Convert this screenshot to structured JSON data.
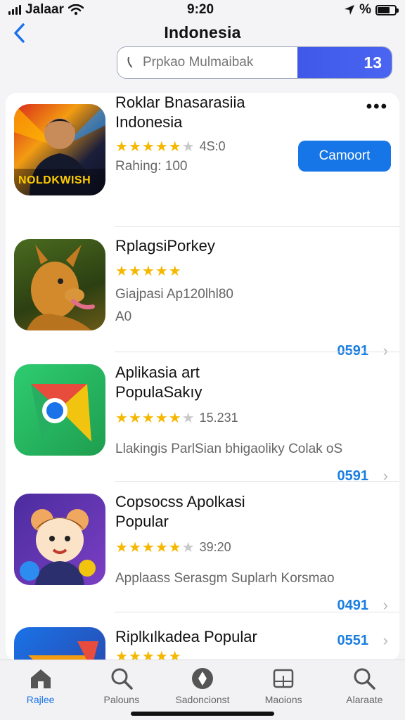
{
  "status": {
    "carrier": "Jalaar",
    "time": "9:20",
    "extra": "%"
  },
  "header": {
    "title": "Indonesia"
  },
  "search": {
    "placeholder": "Prpkao Mulmaibak",
    "count": "13"
  },
  "featured": {
    "name": "Roklar Bnasarasiia Indonesia",
    "rating": "4S:0",
    "sub": "Rahing: 100",
    "action_label": "Camoort",
    "icon_text": "NOLDKWISH"
  },
  "apps": [
    {
      "name": "RplagsiPorkey",
      "rating": "",
      "sub1": "Giajpasi Ap120lhl80",
      "sub2": "A0",
      "price": "0591"
    },
    {
      "name": "Aplikasia art PopulaSakıy",
      "rating": "15.231",
      "sub1": "Llakingis ParlSian bhigaoliky Colak oS",
      "price": "0591"
    },
    {
      "name": "Copsocss Apolkasi Popular",
      "rating": "39:20",
      "sub1": "Applaass Serasgm Suplarh Korsmao",
      "price": "0491"
    },
    {
      "name": "Riplkılkadea Popular",
      "price": "0551"
    }
  ],
  "tabs": [
    {
      "label": "Rajlee",
      "icon": "home-icon"
    },
    {
      "label": "Palouns",
      "icon": "search-icon"
    },
    {
      "label": "Sadoncionst",
      "icon": "compass-icon"
    },
    {
      "label": "Maoions",
      "icon": "board-icon"
    },
    {
      "label": "Alaraate",
      "icon": "search-icon"
    }
  ],
  "colors": {
    "accent": "#1676e8",
    "star": "#f5b800",
    "search_count_bg": "#4a65f2"
  }
}
